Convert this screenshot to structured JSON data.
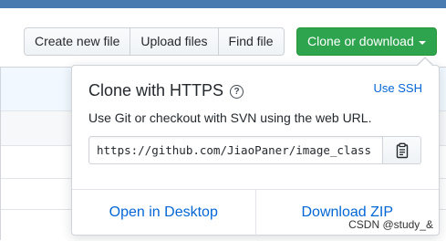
{
  "toolbar": {
    "create_new_file": "Create new file",
    "upload_files": "Upload files",
    "find_file": "Find file",
    "clone_or_download": "Clone or download"
  },
  "clone_popover": {
    "title": "Clone with HTTPS",
    "use_ssh": "Use SSH",
    "description": "Use Git or checkout with SVN using the web URL.",
    "url": "https://github.com/JiaoPaner/image_class",
    "open_in_desktop": "Open in Desktop",
    "download_zip": "Download ZIP"
  },
  "watermark": "CSDN @study_&",
  "icons": {
    "help": "question-circle-icon",
    "copy": "clipboard-icon",
    "caret": "caret-down-icon"
  },
  "colors": {
    "primary_green": "#2ea44f",
    "link_blue": "#0366d6",
    "header_blue": "#4a7bb0"
  }
}
